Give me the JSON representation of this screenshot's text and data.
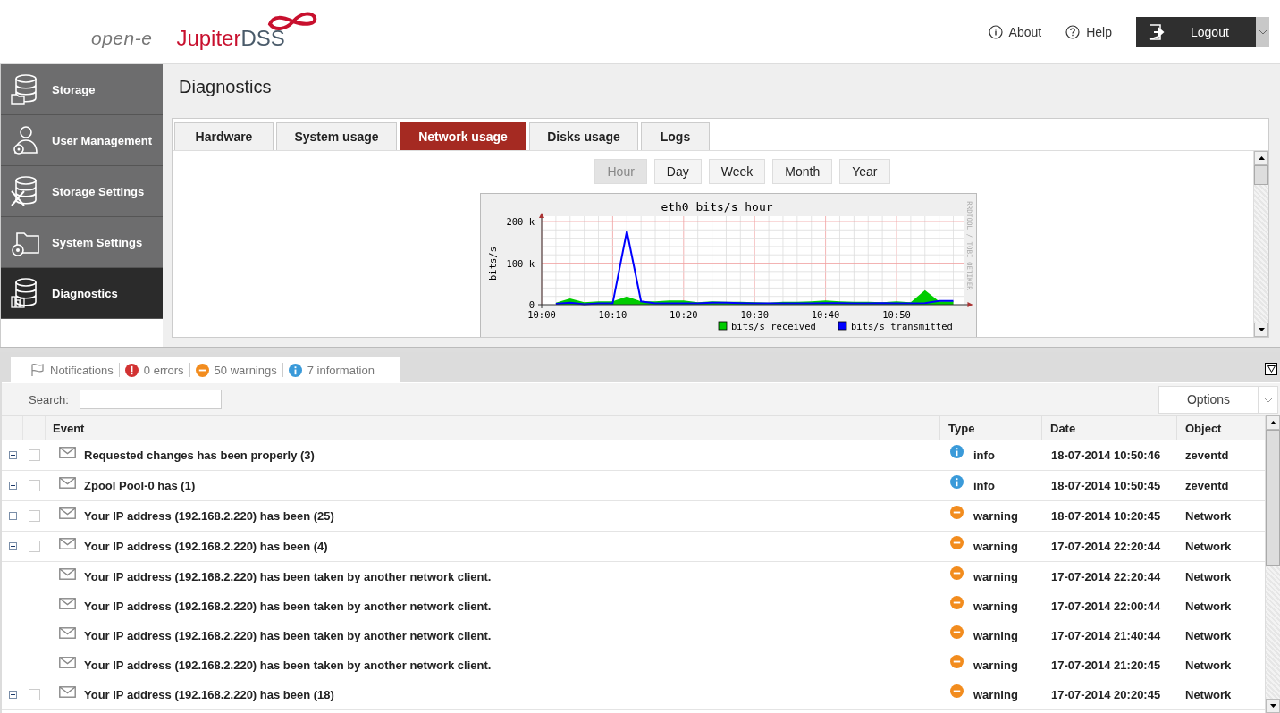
{
  "header": {
    "logo_left": "open-e",
    "logo_right_a": "Jupiter",
    "logo_right_b": "DSS",
    "links": [
      {
        "label": "About",
        "kind": "info"
      },
      {
        "label": "Help",
        "kind": "help"
      }
    ],
    "logout": "Logout"
  },
  "sidebar": {
    "items": [
      {
        "label": "Storage",
        "kind": "storage",
        "selected": false
      },
      {
        "label": "User Management",
        "kind": "user",
        "selected": false
      },
      {
        "label": "Storage Settings",
        "kind": "storage-settings",
        "selected": false
      },
      {
        "label": "System Settings",
        "kind": "system",
        "selected": false
      },
      {
        "label": "Diagnostics",
        "kind": "diagnostics",
        "selected": true
      }
    ]
  },
  "page": {
    "title": "Diagnostics",
    "tabs": [
      {
        "label": "Hardware",
        "selected": false
      },
      {
        "label": "System usage",
        "selected": false
      },
      {
        "label": "Network usage",
        "selected": true
      },
      {
        "label": "Disks usage",
        "selected": false
      },
      {
        "label": "Logs",
        "selected": false
      }
    ],
    "periods": [
      {
        "label": "Hour",
        "selected": true
      },
      {
        "label": "Day",
        "selected": false
      },
      {
        "label": "Week",
        "selected": false
      },
      {
        "label": "Month",
        "selected": false
      },
      {
        "label": "Year",
        "selected": false
      }
    ],
    "chart_data": {
      "type": "area",
      "title": "eth0 bits/s hour",
      "ylabel": "bits/s",
      "grid": true,
      "legend": true,
      "categories": [
        "10:00",
        null,
        null,
        null,
        null,
        "10:10",
        null,
        null,
        null,
        null,
        "10:20",
        null,
        null,
        null,
        null,
        "10:30",
        null,
        null,
        null,
        null,
        "10:40",
        null,
        null,
        null,
        null,
        "10:50",
        null,
        null,
        null,
        null
      ],
      "series": [
        {
          "name": "bits/s received",
          "type": "area",
          "color": "#00cc00",
          "values": [
            null,
            5000,
            15000,
            6000,
            8000,
            8000,
            20000,
            8000,
            8000,
            10000,
            10000,
            6000,
            8000,
            7000,
            7000,
            6000,
            5000,
            7000,
            7000,
            8000,
            10000,
            8000,
            7000,
            7000,
            6000,
            8000,
            6000,
            35000,
            8000,
            8000
          ]
        },
        {
          "name": "bits/s transmitted",
          "type": "line",
          "color": "#0000ff",
          "values": [
            null,
            2000,
            5000,
            1000,
            3000,
            3000,
            177000,
            8000,
            3000,
            3000,
            3000,
            3000,
            5000,
            5000,
            4000,
            3000,
            3000,
            3000,
            3000,
            3000,
            4000,
            4000,
            3000,
            3000,
            4000,
            3000,
            3000,
            4000,
            9000,
            9000
          ]
        }
      ],
      "ylim": [
        0,
        200000
      ],
      "yticks": [
        {
          "value": 0,
          "label": "0"
        },
        {
          "value": 100000,
          "label": "100 k"
        },
        {
          "value": 200000,
          "label": "200 k"
        }
      ]
    },
    "chart_credit": "RRDTOOL / TOBI OETIKER"
  },
  "notifications": {
    "title": "Notifications",
    "counts": [
      {
        "label": "0 errors",
        "kind": "error"
      },
      {
        "label": "50 warnings",
        "kind": "warning"
      },
      {
        "label": "7 information",
        "kind": "info"
      }
    ],
    "search_label": "Search:",
    "options": "Options",
    "columns": [
      "Event",
      "Type",
      "Date",
      "Object"
    ],
    "rows": [
      {
        "kind": "group",
        "expanded": false,
        "checked": false,
        "event": "Requested changes has been properly (3)",
        "color": "#3a9ad9",
        "type": "info",
        "date": "18-07-2014 10:50:46",
        "object": "zeventd"
      },
      {
        "kind": "group",
        "expanded": false,
        "checked": false,
        "event": "Zpool Pool-0 has (1)",
        "color": "#3a9ad9",
        "type": "info",
        "date": "18-07-2014 10:50:45",
        "object": "zeventd"
      },
      {
        "kind": "group",
        "expanded": false,
        "checked": false,
        "event": "Your IP address (192.168.2.220) has been (25)",
        "color": "#f28c1e",
        "type": "warning",
        "date": "18-07-2014 10:20:45",
        "object": "Network"
      },
      {
        "kind": "group",
        "expanded": true,
        "checked": false,
        "event": "Your IP address (192.168.2.220) has been (4)",
        "color": "#f28c1e",
        "type": "warning",
        "date": "17-07-2014 22:20:44",
        "object": "Network"
      },
      {
        "kind": "child",
        "event": "Your IP address (192.168.2.220) has been taken by another network client.",
        "color": "#f28c1e",
        "type": "warning",
        "date": "17-07-2014 22:20:44",
        "object": "Network"
      },
      {
        "kind": "child",
        "event": "Your IP address (192.168.2.220) has been taken by another network client.",
        "color": "#f28c1e",
        "type": "warning",
        "date": "17-07-2014 22:00:44",
        "object": "Network"
      },
      {
        "kind": "child",
        "event": "Your IP address (192.168.2.220) has been taken by another network client.",
        "color": "#f28c1e",
        "type": "warning",
        "date": "17-07-2014 21:40:44",
        "object": "Network"
      },
      {
        "kind": "child",
        "event": "Your IP address (192.168.2.220) has been taken by another network client.",
        "color": "#f28c1e",
        "type": "warning",
        "date": "17-07-2014 21:20:45",
        "object": "Network"
      },
      {
        "kind": "group",
        "expanded": false,
        "checked": false,
        "event": "Your IP address (192.168.2.220) has been (18)",
        "color": "#f28c1e",
        "type": "warning",
        "date": "17-07-2014 20:20:45",
        "object": "Network"
      }
    ]
  }
}
